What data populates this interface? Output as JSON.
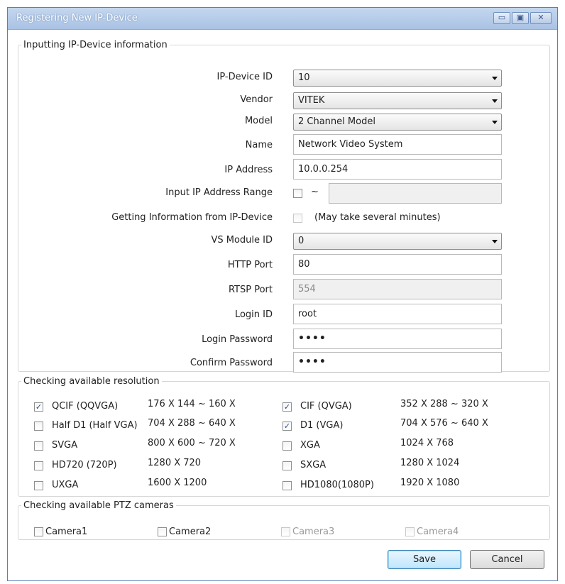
{
  "window": {
    "title": "Registering New IP-Device",
    "minimize_glyph": "▭",
    "restore_glyph": "▣",
    "close_glyph": "✕"
  },
  "info_group": {
    "legend": "Inputting IP-Device information",
    "device_id": {
      "label": "IP-Device ID",
      "value": "10"
    },
    "vendor": {
      "label": "Vendor",
      "value": "VITEK"
    },
    "model": {
      "label": "Model",
      "value": "2 Channel Model"
    },
    "name": {
      "label": "Name",
      "value": "Network Video System"
    },
    "ip_address": {
      "label": "IP Address",
      "value": "10.0.0.254"
    },
    "ip_range": {
      "label": "Input IP Address Range",
      "tilde": "~",
      "value": "",
      "checked": false
    },
    "get_info": {
      "label": "Getting Information from IP-Device",
      "note": "(May take several minutes)",
      "checked": false
    },
    "vs_module": {
      "label": "VS Module ID",
      "value": "0"
    },
    "http_port": {
      "label": "HTTP Port",
      "value": "80"
    },
    "rtsp_port": {
      "label": "RTSP Port",
      "value": "554"
    },
    "login_id": {
      "label": "Login ID",
      "value": "root"
    },
    "login_password": {
      "label": "Login Password",
      "value": "••••"
    },
    "confirm_password": {
      "label": "Confirm Password",
      "value": "••••"
    }
  },
  "resolution_group": {
    "legend": "Checking available resolution",
    "items": [
      {
        "label": "QCIF (QQVGA)",
        "value": "176 X 144 ~ 160 X",
        "checked": true
      },
      {
        "label": "CIF (QVGA)",
        "value": "352 X 288 ~ 320 X",
        "checked": true
      },
      {
        "label": "Half D1 (Half VGA)",
        "value": "704 X 288 ~ 640 X",
        "checked": false
      },
      {
        "label": "D1 (VGA)",
        "value": "704 X 576 ~ 640 X",
        "checked": true
      },
      {
        "label": "SVGA",
        "value": "800 X 600 ~ 720 X",
        "checked": false
      },
      {
        "label": "XGA",
        "value": "1024 X 768",
        "checked": false
      },
      {
        "label": "HD720 (720P)",
        "value": "1280 X 720",
        "checked": false
      },
      {
        "label": "SXGA",
        "value": "1280 X 1024",
        "checked": false
      },
      {
        "label": "UXGA",
        "value": "1600 X 1200",
        "checked": false
      },
      {
        "label": "HD1080(1080P)",
        "value": "1920 X 1080",
        "checked": false
      }
    ]
  },
  "ptz_group": {
    "legend": "Checking available PTZ cameras",
    "cameras": [
      {
        "label": "Camera1",
        "checked": false,
        "enabled": true
      },
      {
        "label": "Camera2",
        "checked": false,
        "enabled": true
      },
      {
        "label": "Camera3",
        "checked": false,
        "enabled": false
      },
      {
        "label": "Camera4",
        "checked": false,
        "enabled": false
      }
    ]
  },
  "buttons": {
    "save": "Save",
    "cancel": "Cancel"
  },
  "check_glyph": "✓"
}
